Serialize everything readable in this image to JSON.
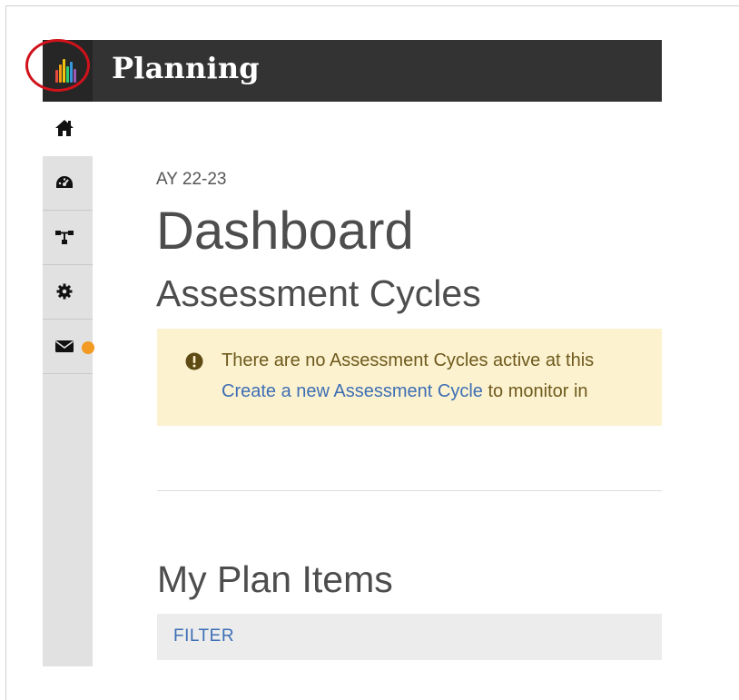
{
  "header": {
    "app_title": "Planning",
    "logo_icon": "bar-chart-logo-icon",
    "highlight_color": "#d0121b",
    "background_color": "#333333"
  },
  "sidebar": {
    "items": [
      {
        "icon": "home-icon",
        "active": true
      },
      {
        "icon": "dashboard-gauge-icon",
        "active": false
      },
      {
        "icon": "sitemap-icon",
        "active": false
      },
      {
        "icon": "gear-icon",
        "active": false
      },
      {
        "icon": "envelope-icon",
        "active": false,
        "has_notification": true
      }
    ],
    "notification_color": "#f39a22"
  },
  "main": {
    "academic_year": "AY 22-23",
    "page_title": "Dashboard",
    "section_title": "Assessment Cycles",
    "alert": {
      "icon": "exclamation-circle-icon",
      "line1": "There are no Assessment Cycles active at this",
      "link_text": "Create a new Assessment Cycle",
      "line2_rest": " to monitor in"
    },
    "plan_items_title": "My Plan Items",
    "filter_label": "FILTER"
  }
}
